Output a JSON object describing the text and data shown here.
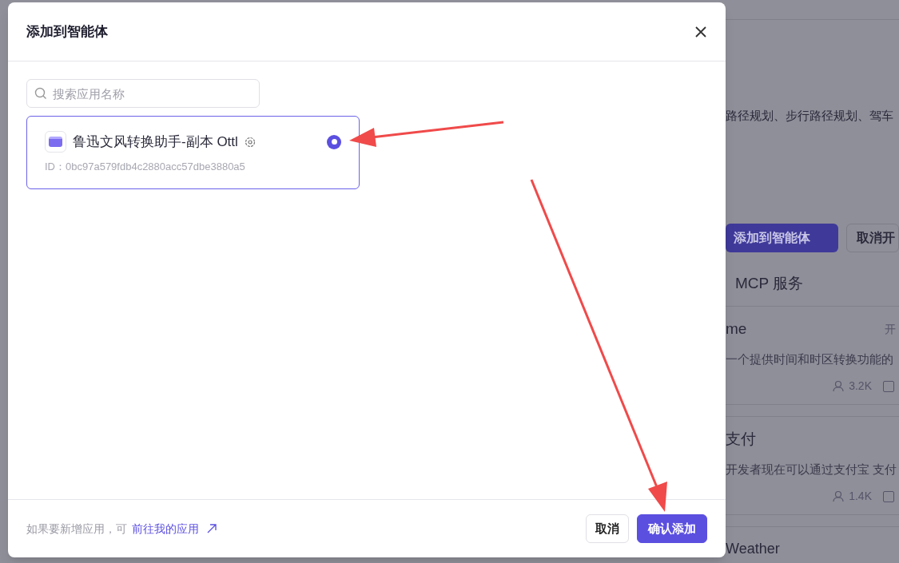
{
  "background": {
    "route_text": "路径规划、步行路径规划、驾车",
    "add_button": "添加到智能体",
    "cancel_button": "取消开",
    "section_title": "MCP 服务",
    "services": [
      {
        "name": "me",
        "status": "开",
        "description": "一个提供时间和时区转换功能的",
        "users": "3.2K"
      },
      {
        "name": "支付",
        "description": "开发者现在可以通过支付宝 支付",
        "users": "1.4K"
      },
      {
        "name": "Weather"
      }
    ]
  },
  "dialog": {
    "title": "添加到智能体",
    "search": {
      "placeholder": "搜索应用名称"
    },
    "apps": [
      {
        "name": "鲁迅文风转换助手-副本 Ottl",
        "id": "ID：0bc97a579fdb4c2880acc57dbe3880a5",
        "selected": true
      }
    ],
    "footer": {
      "hint": "如果要新增应用，可",
      "link": "前往我的应用"
    },
    "buttons": [
      {
        "label": "取消",
        "kind": "secondary"
      },
      {
        "label": "确认添加",
        "kind": "primary"
      }
    ]
  }
}
